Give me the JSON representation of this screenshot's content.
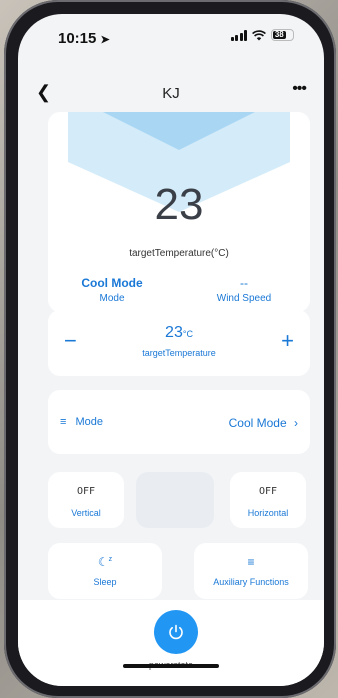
{
  "status_bar": {
    "time": "10:15",
    "battery": "38"
  },
  "nav": {
    "title": "KJ",
    "back_icon": "chevron-left-icon",
    "more_icon": "more-icon"
  },
  "climate": {
    "temperature": "23",
    "temperature_label": "targetTemperature(°C)",
    "mode_value": "Cool Mode",
    "mode_label": "Mode",
    "wind_value": "--",
    "wind_label": "Wind Speed"
  },
  "stepper": {
    "minus": "−",
    "plus": "+",
    "value": "23",
    "unit": "°C",
    "label": "targetTemperature"
  },
  "mode_row": {
    "icon": "≡",
    "label": "Mode",
    "value": "Cool Mode",
    "chevron": "›"
  },
  "swing": {
    "vertical": {
      "state": "OFF",
      "label": "Vertical"
    },
    "horizontal": {
      "state": "OFF",
      "label": "Horizontal"
    }
  },
  "functions": {
    "sleep": {
      "label": "Sleep"
    },
    "auxiliary": {
      "icon": "≡",
      "label": "Auxiliary Functions"
    }
  },
  "power": {
    "label": "powerstate"
  },
  "colors": {
    "accent": "#1a78d6",
    "power": "#2196f3",
    "hex": "#bfe2f7"
  }
}
